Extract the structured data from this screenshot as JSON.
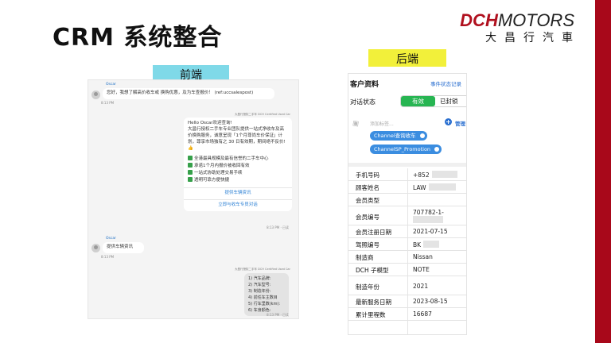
{
  "slide": {
    "title": "CRM 系统整合",
    "logo": {
      "dch": "DCH",
      "motors": "MOTORS",
      "subtitle": "大昌行汽車"
    },
    "brand_color": "#a8081a",
    "labels": {
      "front": "前端",
      "back": "后端"
    }
  },
  "chat": {
    "sender_name": "Oscar",
    "msg1": "您好，我想了解高价收车或 换购优惠，及为车查报价！ (ref:uccsalespost)",
    "msg1_time": "8:13 PM",
    "bot_meta": "大昌行授权二手车 DCH Certified Used Car",
    "reply_greeting": "Hello Oscar欢迎查询!",
    "reply_body": "大昌行授权二手车专业团队提供一站式净收车及高价换购服务，诚意呈现「1个月尊尚车价保证」计划，尊享市场独有之 30 日有效期，期间绝不反价! 👍",
    "features": [
      "全港最具规模及最有信誉的二手车中心",
      "承诺1个月内报价被收回有效",
      "一站式协助处理交易手续",
      "透明可靠方便快捷"
    ],
    "btn_vehicle": "提供车辆资讯",
    "btn_contact": "立即与收车专员对话",
    "reply_time": "8:13 PM · 已读",
    "msg2": "提供车辆资讯",
    "msg2_time": "8:13 PM",
    "form_lines": [
      "1) 汽车品牌:",
      "2) 汽车型号:",
      "3) 制造年份:",
      "4) 前任车主数目",
      "5) 行车里数(km):",
      "6) 车身颜色:"
    ],
    "form_time": "8:13 PM · 已读"
  },
  "crm": {
    "title": "客户资料",
    "event_log": "事件状态记录",
    "dialog_status_label": "对话状态",
    "status_active": "有效",
    "status_blocked": "已封锁",
    "tag_placeholder": "添加标签...",
    "manage": "管理",
    "tags": [
      "Channel查询收车",
      "ChannelSP_Promotion"
    ],
    "fields": [
      {
        "k": "手机号码",
        "v": "+852"
      },
      {
        "k": "顾客姓名",
        "v": "LAW"
      },
      {
        "k": "会员类型",
        "v": ""
      },
      {
        "k": "会员编号",
        "v": "707782-1-"
      },
      {
        "k": "会员注册日期",
        "v": "2021-07-15"
      },
      {
        "k": "驾照编号",
        "v": "BK"
      },
      {
        "k": "制造商",
        "v": "Nissan"
      },
      {
        "k": "DCH 子模型",
        "v": "NOTE"
      },
      {
        "k": "制造年份",
        "v": "2021"
      },
      {
        "k": "最新服务日期",
        "v": "2023-08-15"
      },
      {
        "k": "累计里程数",
        "v": "16687"
      }
    ]
  }
}
